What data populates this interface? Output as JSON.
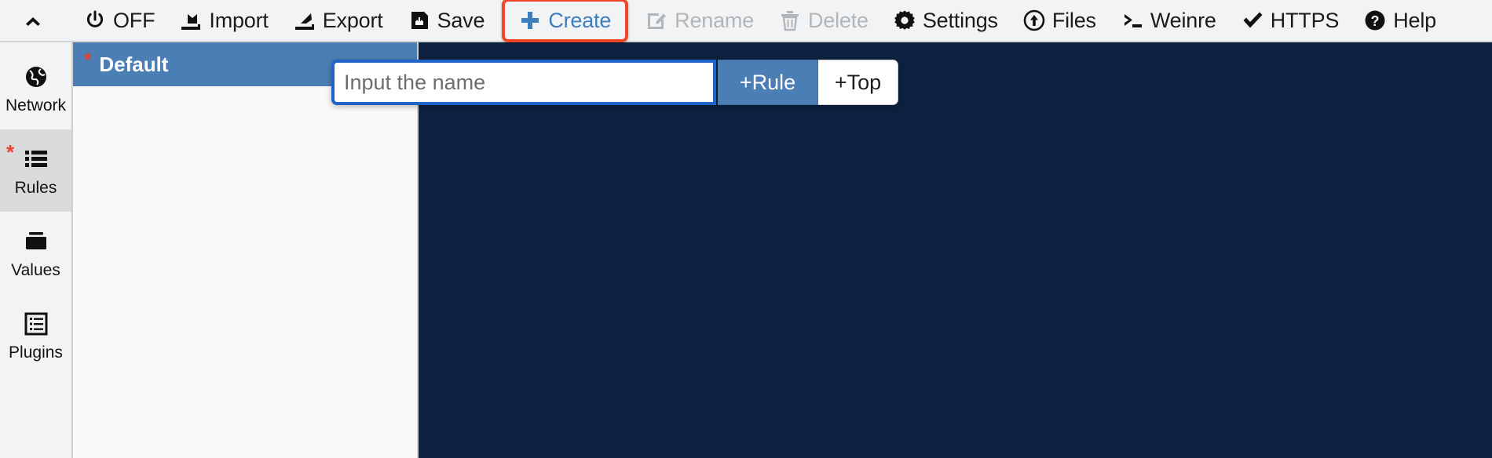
{
  "toolbar": {
    "items": [
      {
        "id": "collapse",
        "icon": "chevron-up-icon",
        "label": "",
        "state": "normal"
      },
      {
        "id": "power",
        "icon": "power-icon",
        "label": "OFF",
        "state": "normal"
      },
      {
        "id": "import",
        "icon": "import-icon",
        "label": "Import",
        "state": "normal"
      },
      {
        "id": "export",
        "icon": "export-icon",
        "label": "Export",
        "state": "normal"
      },
      {
        "id": "save",
        "icon": "save-icon",
        "label": "Save",
        "state": "normal"
      },
      {
        "id": "create",
        "icon": "plus-icon",
        "label": "Create",
        "state": "highlighted"
      },
      {
        "id": "rename",
        "icon": "rename-icon",
        "label": "Rename",
        "state": "disabled"
      },
      {
        "id": "delete",
        "icon": "trash-icon",
        "label": "Delete",
        "state": "disabled"
      },
      {
        "id": "settings",
        "icon": "gear-icon",
        "label": "Settings",
        "state": "normal"
      },
      {
        "id": "files",
        "icon": "upload-circle-icon",
        "label": "Files",
        "state": "normal"
      },
      {
        "id": "weinre",
        "icon": "terminal-icon",
        "label": "Weinre",
        "state": "normal"
      },
      {
        "id": "https",
        "icon": "check-icon",
        "label": "HTTPS",
        "state": "normal"
      },
      {
        "id": "help",
        "icon": "question-circle-icon",
        "label": "Help",
        "state": "normal"
      }
    ],
    "highlight_color": "#f0462a",
    "create_text_color": "#3d7ebf"
  },
  "sidebar": {
    "items": [
      {
        "id": "network",
        "icon": "globe-icon",
        "label": "Network",
        "active": false,
        "modified": false
      },
      {
        "id": "rules",
        "icon": "list-icon",
        "label": "Rules",
        "active": true,
        "modified": true
      },
      {
        "id": "values",
        "icon": "folder-icon",
        "label": "Values",
        "active": false,
        "modified": false
      },
      {
        "id": "plugins",
        "icon": "plugins-icon",
        "label": "Plugins",
        "active": false,
        "modified": false
      }
    ],
    "modified_marker": "*",
    "modified_color": "#e8402a",
    "active_bg": "#d9dadc"
  },
  "list_panel": {
    "rows": [
      {
        "id": "default",
        "name": "Default",
        "selected": true,
        "modified": true,
        "marker": "*"
      }
    ],
    "selected_bg": "#4b7eb4"
  },
  "editor": {
    "background": "#0d2240",
    "content": ""
  },
  "create_dialog": {
    "input": {
      "value": "",
      "placeholder": "Input the name",
      "focused": true,
      "focus_border_color": "#1f63c8"
    },
    "buttons": [
      {
        "id": "add-rule",
        "label": "+Rule",
        "primary": true
      },
      {
        "id": "add-top",
        "label": "+Top",
        "primary": false
      }
    ]
  }
}
